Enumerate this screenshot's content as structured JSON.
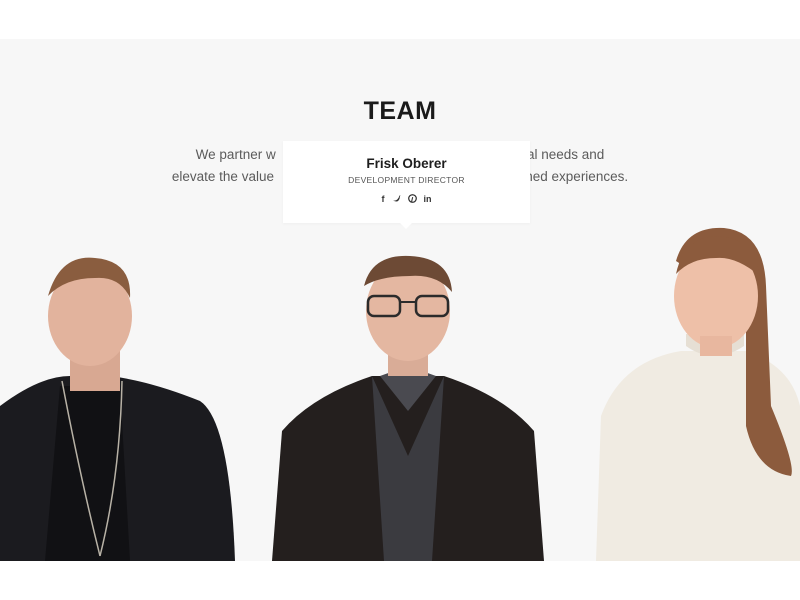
{
  "team": {
    "title": "TEAM",
    "intro_line1": "We partner w                                                                   al needs and",
    "intro_line2": "elevate the value                                                                   ned experiences."
  },
  "tooltip": {
    "name": "Frisk Oberer",
    "role": "DEVELOPMENT DIRECTOR",
    "social": {
      "facebook": "f",
      "twitter": "🐦",
      "pinterest": "℗",
      "linkedin": "in"
    }
  },
  "members": [
    {
      "photo": "member-photo-left"
    },
    {
      "photo": "member-photo-frisk-oberer"
    },
    {
      "photo": "member-photo-right"
    }
  ]
}
